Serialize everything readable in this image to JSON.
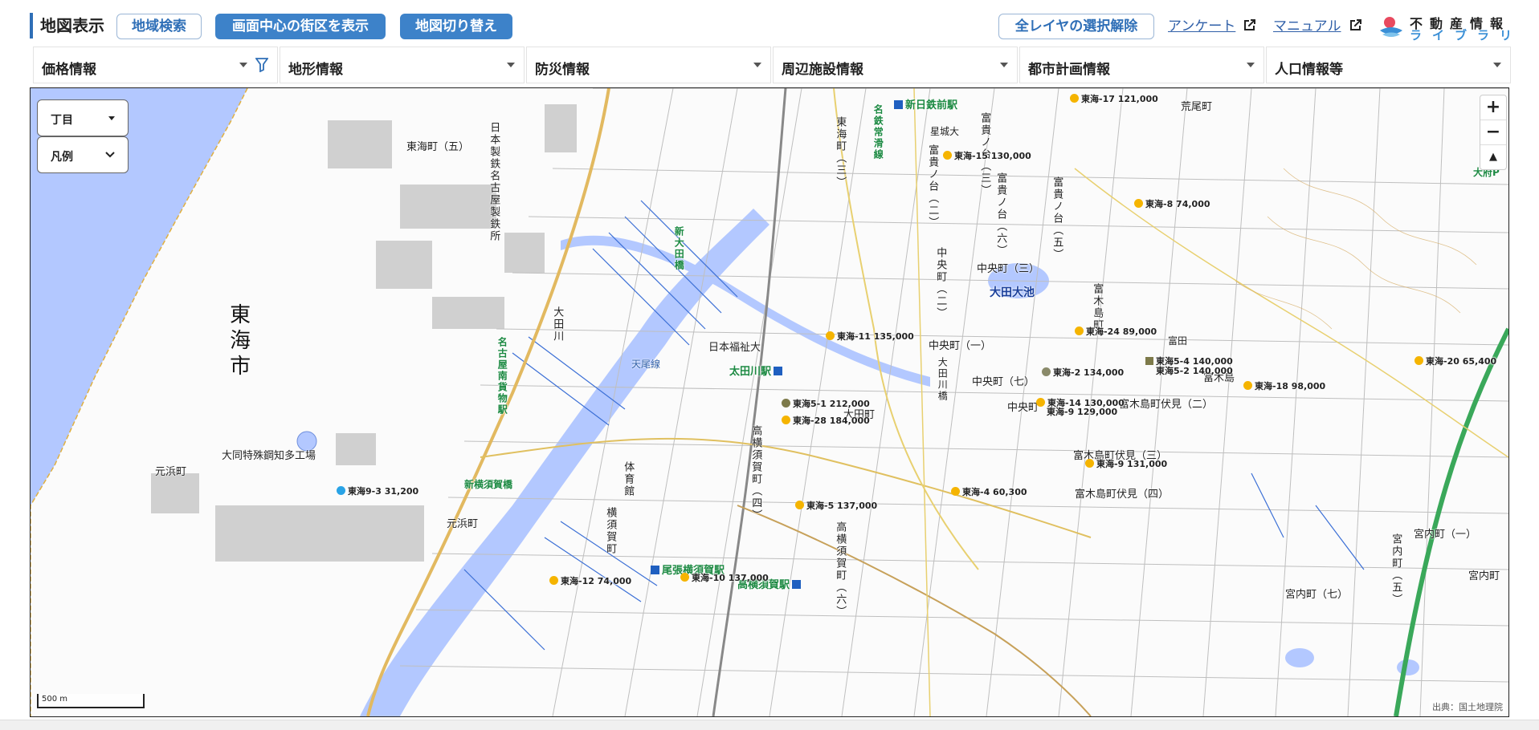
{
  "header": {
    "title": "地図表示",
    "search_button": "地域検索",
    "center_button": "画面中心の街区を表示",
    "switch_button": "地図切り替え",
    "clear_button": "全レイヤの選択解除",
    "survey_link": "アンケート",
    "manual_link": "マニュアル",
    "logo_line1": "不動産情報",
    "logo_line2": "ライブラリ"
  },
  "filters": [
    {
      "label": "価格情報"
    },
    {
      "label": "地形情報"
    },
    {
      "label": "防災情報"
    },
    {
      "label": "周辺施設情報"
    },
    {
      "label": "都市計画情報"
    },
    {
      "label": "人口情報等"
    }
  ],
  "map_controls": {
    "area_select": "丁目",
    "legend_select": "凡例",
    "zoom_in": "+",
    "zoom_out": "−",
    "north": "▲",
    "scale": "500 m",
    "credit": "出典：国土地理院"
  },
  "colors": {
    "accent": "#3d82c9",
    "water": "#b3c8ff",
    "price_dot": "#f5b400",
    "price_dot_alt": "#7d7a4a",
    "station": "#1f5fc0",
    "route": "#1d8a43"
  },
  "map_labels": {
    "city": "東海市",
    "tokaicho5": "東海町（五）",
    "steel": "日本製鉄名古屋製鉄所",
    "tokaicho3": "東海町（三）",
    "shinnittetsu": "新日鉄前駅",
    "hoshijiro": "星城大",
    "meitetsu": "名鉄常滑線",
    "tomiki3": "富貴ノ台（三）",
    "tomiki2": "富貴ノ台（二）",
    "tomiki6": "富貴ノ台（六）",
    "tomiki5": "富貴ノ台（五）",
    "shinota": "新大田橋",
    "otagawa": "大田川",
    "cargo": "名古屋南貨物駅",
    "nfukushi": "日本福祉大",
    "tenyo": "天尾線",
    "otagawa_st": "太田川駅",
    "chuo": "中央町（三）",
    "chuo2": "中央町（二）",
    "chuo1": "中央町（一）",
    "chuo7": "中央町（七）",
    "chuo_b": "中央町",
    "otaike": "大田大池",
    "otacho": "大田町",
    "tomiki_cho": "富木島町",
    "tomikifushimi2": "富木島町伏見（二）",
    "tomikifushimi3": "富木島町伏見（三）",
    "tomikifushimi4": "富木島町伏見（四）",
    "tomiki_b": "富木島",
    "daido": "大同特殊鋼知多工場",
    "motohama": "元浜町",
    "motohama2": "元浜町",
    "shinyokosuka": "新横須賀橋",
    "yokosuka": "横須賀町",
    "yokosuka4": "高横須賀町（四）",
    "yokosuka6": "高横須賀町（六）",
    "owari": "尾張横須賀駅",
    "owari_b": "高横須賀駅",
    "gym": "体育館",
    "miyauchi1": "宮内町（一）",
    "miyauchi5": "宮内町（五）",
    "miyauchi7": "宮内町（七）",
    "miyauchi_b": "宮内町",
    "obu": "大府P",
    "arao": "荒尾町",
    "tomida": "富田",
    "ohashi": "大田川橋"
  },
  "price_points": [
    {
      "label": "東海-17 121,000",
      "color": "#f5b400"
    },
    {
      "label": "東海-15 130,000",
      "color": "#f5b400"
    },
    {
      "label": "東海-8 74,000",
      "color": "#f5b400"
    },
    {
      "label": "東海-11 135,000",
      "color": "#f5b400"
    },
    {
      "label": "東海-24 89,000",
      "color": "#f5b400"
    },
    {
      "label": "東海5-4 140,000",
      "color": "#7d7a4a"
    },
    {
      "label": "東海5-2 140,000",
      "color": "#7d7a4a"
    },
    {
      "label": "東海-20 65,400",
      "color": "#f5b400"
    },
    {
      "label": "東海-2 134,000",
      "color": "#8a8a6a"
    },
    {
      "label": "東海-18 98,000",
      "color": "#f5b400"
    },
    {
      "label": "東海5-1 212,000",
      "color": "#7d7a4a"
    },
    {
      "label": "東海-28 184,000",
      "color": "#f5b400"
    },
    {
      "label": "東海-14 130,000",
      "color": "#f5b400"
    },
    {
      "label": "東海-9 129,000",
      "color": "#f5b400"
    },
    {
      "label": "東海-9 131,000",
      "color": "#f5b400"
    },
    {
      "label": "東海-4 60,300",
      "color": "#f5b400"
    },
    {
      "label": "東海-5 137,000",
      "color": "#f5b400"
    },
    {
      "label": "東海9-3 31,200",
      "color": "#29a3e6"
    },
    {
      "label": "東海-12 74,000",
      "color": "#f5b400"
    },
    {
      "label": "東海-10 137,000",
      "color": "#f5b400"
    }
  ]
}
